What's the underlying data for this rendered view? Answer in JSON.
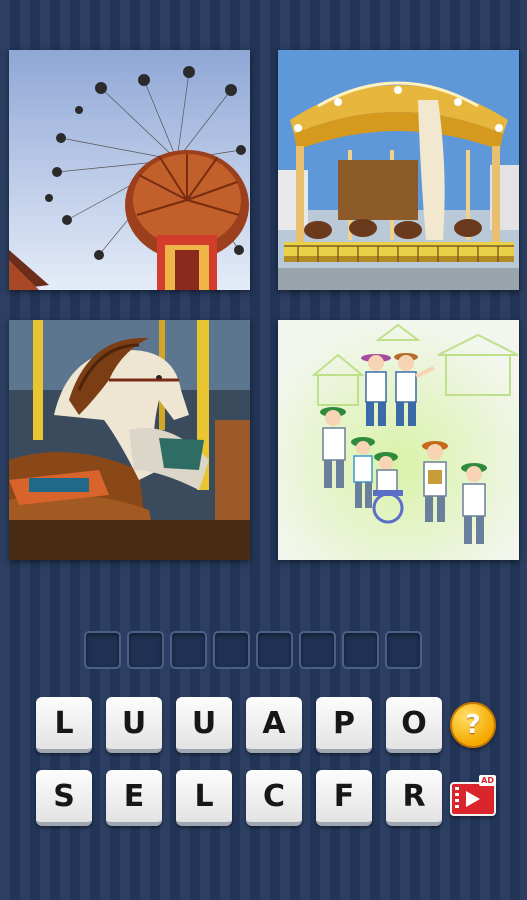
{
  "puzzle": {
    "pictures": [
      {
        "name": "swing-ride-photo"
      },
      {
        "name": "carousel-photo"
      },
      {
        "name": "carousel-horse-photo"
      },
      {
        "name": "group-outing-illustration"
      }
    ],
    "answer_slots": 8
  },
  "keyboard": {
    "rows": [
      [
        "L",
        "U",
        "U",
        "A",
        "P",
        "O"
      ],
      [
        "S",
        "E",
        "L",
        "C",
        "F",
        "R"
      ]
    ]
  },
  "hint_button": {
    "icon": "question-mark-icon",
    "label": "?",
    "color": "#f5a800"
  },
  "ad_button": {
    "icon": "video-ad-icon",
    "label": "AD",
    "color": "#d8262c"
  },
  "theme": {
    "background": "#24385c",
    "slot_border": "#4a6088"
  }
}
